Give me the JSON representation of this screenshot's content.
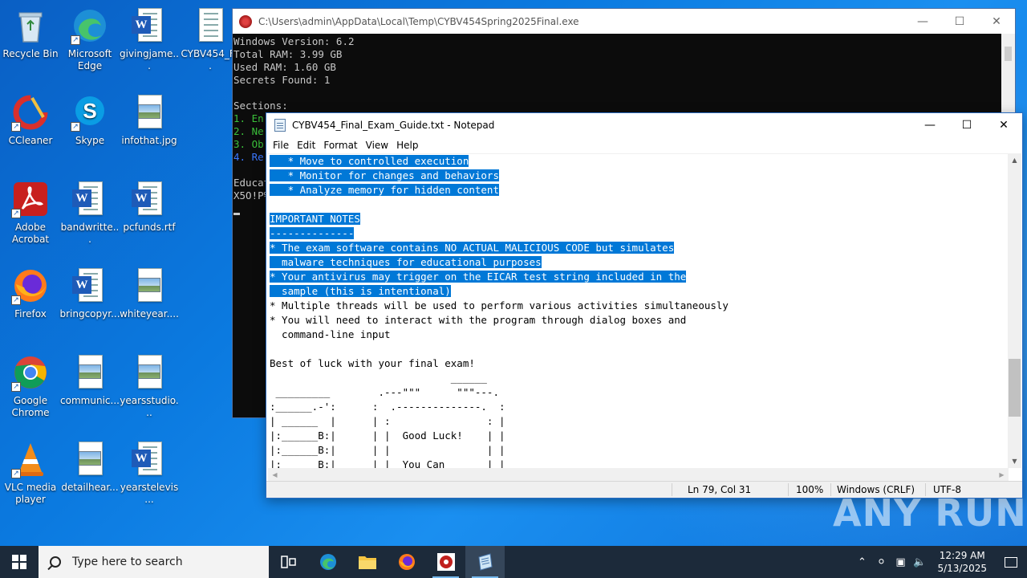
{
  "desktop": {
    "icons": [
      {
        "label": "Recycle Bin",
        "icon": "recycle-bin-icon"
      },
      {
        "label": "Microsoft Edge",
        "icon": "edge-icon"
      },
      {
        "label": "givingjame...",
        "icon": "word-doc-icon"
      },
      {
        "label": "CYBV454_F...",
        "icon": "text-file-icon"
      },
      {
        "label": "CCleaner",
        "icon": "ccleaner-icon"
      },
      {
        "label": "Skype",
        "icon": "skype-icon"
      },
      {
        "label": "infothat.jpg",
        "icon": "image-file-icon"
      },
      {
        "label": "Adobe Acrobat",
        "icon": "acrobat-icon"
      },
      {
        "label": "bandwritte...",
        "icon": "word-doc-icon"
      },
      {
        "label": "pcfunds.rtf",
        "icon": "word-doc-icon"
      },
      {
        "label": "Firefox",
        "icon": "firefox-icon"
      },
      {
        "label": "bringcopyr...",
        "icon": "word-doc-icon"
      },
      {
        "label": "whiteyear....",
        "icon": "image-file-icon"
      },
      {
        "label": "Google Chrome",
        "icon": "chrome-icon"
      },
      {
        "label": "communic...",
        "icon": "image-file-icon"
      },
      {
        "label": "yearsstudio...",
        "icon": "image-file-icon"
      },
      {
        "label": "VLC media player",
        "icon": "vlc-icon"
      },
      {
        "label": "detailhear...",
        "icon": "image-file-icon"
      },
      {
        "label": "yearstelevis...",
        "icon": "word-doc-icon"
      }
    ]
  },
  "console": {
    "title": "C:\\Users\\admin\\AppData\\Local\\Temp\\CYBV454Spring2025Final.exe",
    "lines": {
      "l1": "Windows Version: 6.2",
      "l2": "Total RAM: 3.99 GB",
      "l3": "Used RAM: 1.60 GB",
      "l4": "Secrets Found: 1",
      "l5": "",
      "l6": "Sections:",
      "l7": "1. En",
      "l8": "2. Ne",
      "l9": "3. Ob",
      "l10": "4. Re",
      "l11": "",
      "l12": "Educat",
      "l13": "X5O!P%"
    }
  },
  "notepad": {
    "title": "CYBV454_Final_Exam_Guide.txt - Notepad",
    "menu": [
      "File",
      "Edit",
      "Format",
      "View",
      "Help"
    ],
    "lines": [
      {
        "text": "   * Move to controlled execution",
        "selected": true
      },
      {
        "text": "   * Monitor for changes and behaviors",
        "selected": true
      },
      {
        "text": "   * Analyze memory for hidden content",
        "selected": true
      },
      {
        "text": "",
        "selected": true
      },
      {
        "text": "IMPORTANT NOTES",
        "selected": true
      },
      {
        "text": "--------------",
        "selected": true
      },
      {
        "text": "* The exam software contains NO ACTUAL MALICIOUS CODE but simulates",
        "selected": true
      },
      {
        "text": "  malware techniques for educational purposes",
        "selected": true
      },
      {
        "text": "* Your antivirus may trigger on the EICAR test string included in the",
        "selected": true
      },
      {
        "text": "  sample (this is intentional)",
        "selected": true
      },
      {
        "text": "* Multiple threads will be used to perform various activities simultaneously",
        "selected": false
      },
      {
        "text": "* You will need to interact with the program through dialog boxes and",
        "selected": false
      },
      {
        "text": "  command-line input",
        "selected": false
      },
      {
        "text": "",
        "selected": false
      },
      {
        "text": "Best of luck with your final exam!",
        "selected": false
      },
      {
        "text": "                              ______",
        "selected": false
      },
      {
        "text": " _________        .---\"\"\"      \"\"\"---.",
        "selected": false
      },
      {
        "text": ":______.-':      :  .--------------.  :",
        "selected": false
      },
      {
        "text": "| ______  |      | :                : |",
        "selected": false
      },
      {
        "text": "|:______B:|      | |  Good Luck!    | |",
        "selected": false
      },
      {
        "text": "|:______B:|      | |                | |",
        "selected": false
      },
      {
        "text": "|:______B:|      | |  You Can       | |",
        "selected": false
      }
    ],
    "status": {
      "position": "Ln 79, Col 31",
      "zoom": "100%",
      "line_ending": "Windows (CRLF)",
      "encoding": "UTF-8"
    }
  },
  "watermark": "ANY RUN",
  "taskbar": {
    "search_placeholder": "Type here to search",
    "time": "12:29 AM",
    "date": "5/13/2025"
  }
}
